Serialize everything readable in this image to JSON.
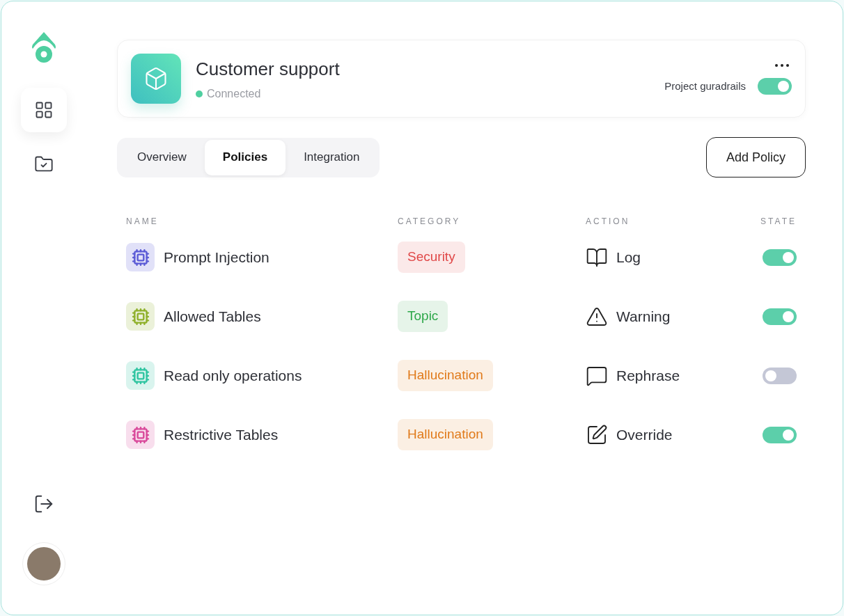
{
  "sidebar": {
    "items": [
      {
        "kind": "grid",
        "selected": true
      },
      {
        "kind": "folder",
        "selected": false
      }
    ]
  },
  "project": {
    "title": "Customer support",
    "status": "Connected",
    "connected": true,
    "toggle_label": "Project guradrails",
    "on": true
  },
  "tabs": [
    {
      "label": "Overview",
      "selected": false
    },
    {
      "label": "Policies",
      "selected": true
    },
    {
      "label": "Integration",
      "selected": false
    }
  ],
  "add_button": "Add Policy",
  "table": {
    "columns": [
      "NAME",
      "CATEGORY",
      "ACTION",
      "STATE"
    ],
    "rows": [
      {
        "name": "Prompt Injection",
        "color": "#5b5bd6",
        "category": {
          "label": "Security",
          "color": "#e04848"
        },
        "action": {
          "kind": "log",
          "label": "Log"
        },
        "on": true
      },
      {
        "name": "Allowed Tables",
        "color": "#8fb02a",
        "category": {
          "label": "Topic",
          "color": "#2ea84a"
        },
        "action": {
          "kind": "warning",
          "label": "Warning"
        },
        "on": true
      },
      {
        "name": "Read only operations",
        "color": "#2ec4a0",
        "category": {
          "label": "Hallucination",
          "color": "#e07a1a"
        },
        "action": {
          "kind": "rephrase",
          "label": "Rephrase"
        },
        "on": false
      },
      {
        "name": "Restrictive Tables",
        "color": "#d9489a",
        "category": {
          "label": "Hallucination",
          "color": "#e07a1a"
        },
        "action": {
          "kind": "override",
          "label": "Override"
        },
        "on": true
      }
    ]
  }
}
